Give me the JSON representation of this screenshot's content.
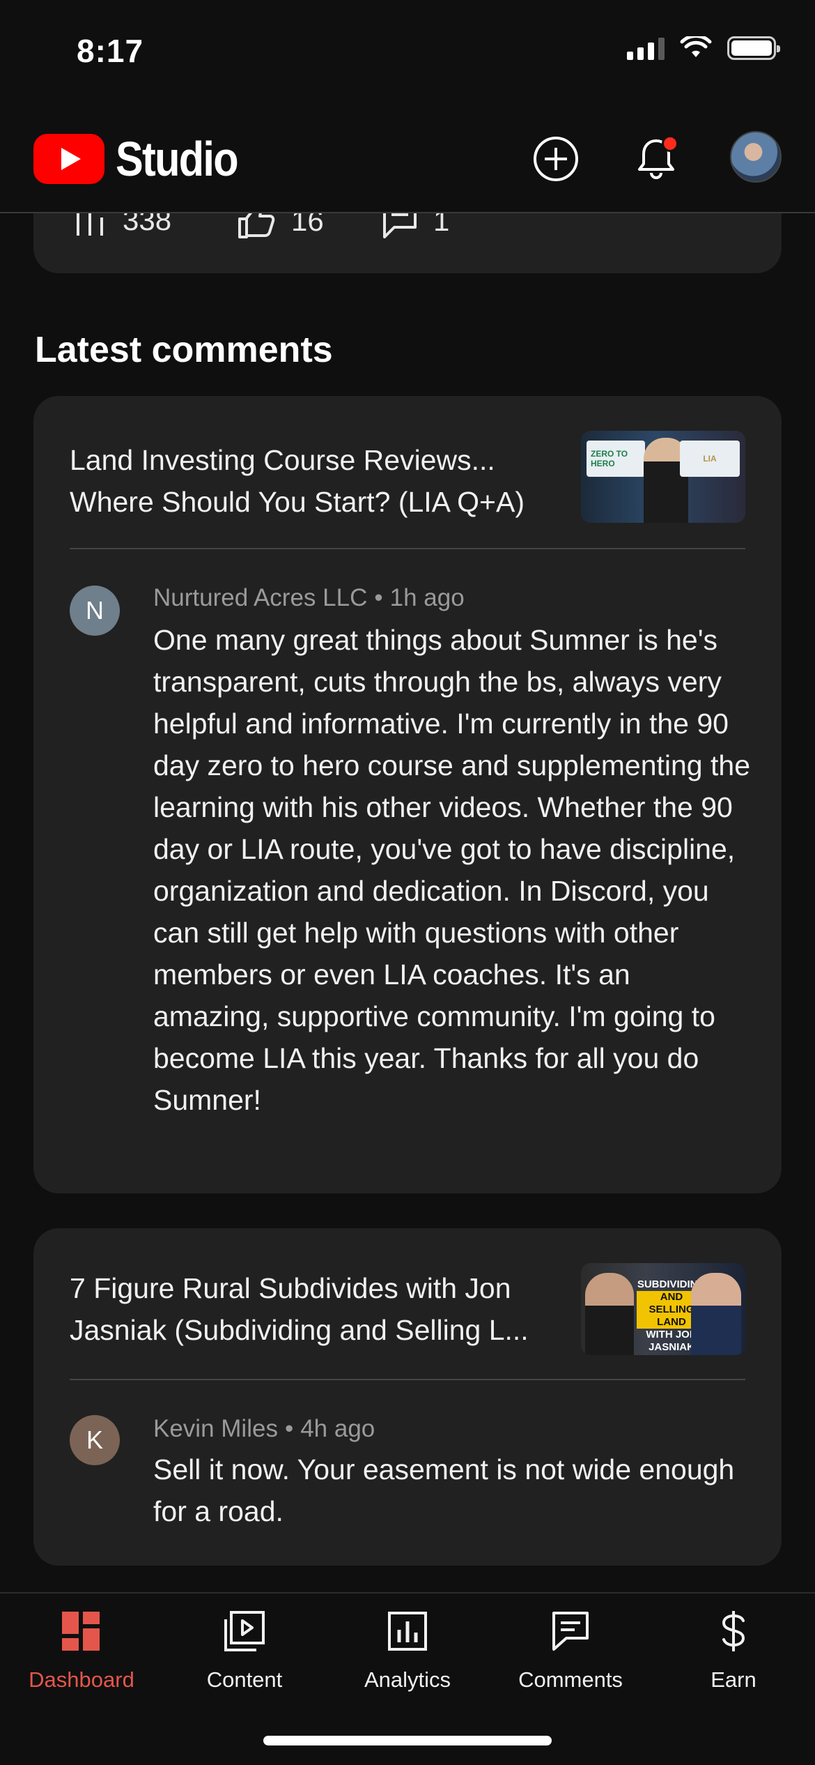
{
  "status_bar": {
    "time": "8:17"
  },
  "header": {
    "app_name": "Studio"
  },
  "stats": {
    "views": "338",
    "likes": "16",
    "comments": "1"
  },
  "section": {
    "title": "Latest comments"
  },
  "comments": [
    {
      "video_title": "Land Investing Course Reviews... Where Should You Start? (LIA Q+A)",
      "thumbnail_badges": [
        "ZERO TO HERO",
        "LIA"
      ],
      "author_initial": "N",
      "author": "Nurtured Acres LLC",
      "time": "1h ago",
      "text": "One many great things about Sumner is he's transparent, cuts through the bs, always very helpful and informative. I'm currently in the 90 day zero to hero course and supplementing the learning with his other videos. Whether the 90 day or LIA route, you've got to have discipline, organization and dedication. In Discord, you can still get help with questions with other members or even LIA coaches. It's an amazing, supportive community. I'm going to become LIA this year. Thanks for all you do Sumner!"
    },
    {
      "video_title": "7 Figure Rural Subdivides with Jon Jasniak (Subdividing and Selling L...",
      "thumbnail_lines": [
        "SUBDIVIDING",
        "AND SELLING LAND",
        "WITH JON JASNIAK"
      ],
      "author_initial": "K",
      "author": "Kevin Miles",
      "time": "4h ago",
      "text": "Sell it now. Your easement is not wide enough for a road."
    }
  ],
  "nav": {
    "items": [
      {
        "label": "Dashboard",
        "icon": "dashboard-icon",
        "active": true
      },
      {
        "label": "Content",
        "icon": "content-icon",
        "active": false
      },
      {
        "label": "Analytics",
        "icon": "analytics-icon",
        "active": false
      },
      {
        "label": "Comments",
        "icon": "comments-icon",
        "active": false
      },
      {
        "label": "Earn",
        "icon": "earn-icon",
        "active": false
      }
    ]
  },
  "colors": {
    "background": "#0f0f0f",
    "card": "#212121",
    "brand_red": "#ff0000",
    "active_nav": "#e4564b",
    "notification": "#ff2b1c"
  }
}
